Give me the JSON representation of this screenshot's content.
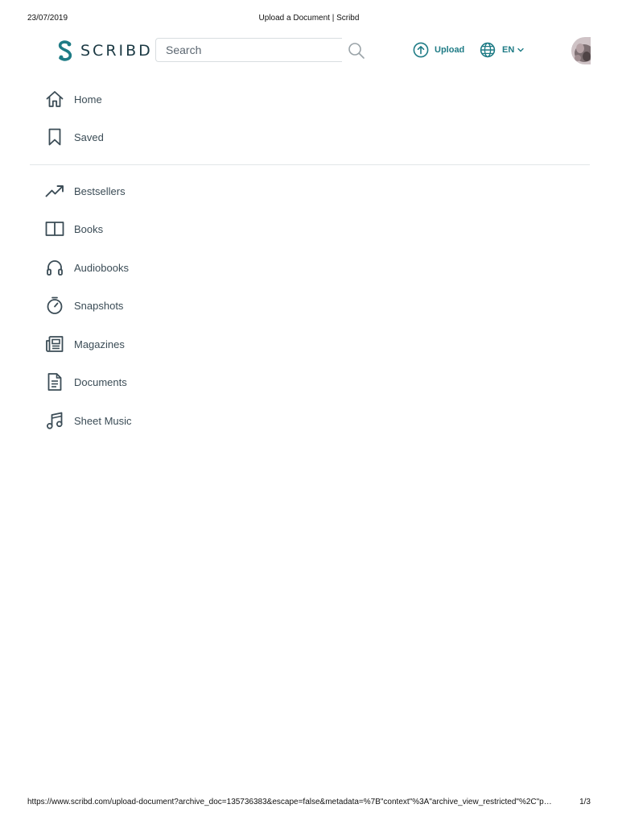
{
  "print": {
    "date": "23/07/2019",
    "title": "Upload a Document | Scribd",
    "url": "https://www.scribd.com/upload-document?archive_doc=135736383&escape=false&metadata=%7B\"context\"%3A\"archive_view_restricted\"%2C\"p…",
    "page": "1/3"
  },
  "header": {
    "logo_text": "SCRIBD",
    "search_placeholder": "Search",
    "upload_label": "Upload",
    "language_label": "EN"
  },
  "nav": {
    "primary": [
      {
        "label": "Home",
        "icon": "home-icon"
      },
      {
        "label": "Saved",
        "icon": "bookmark-icon"
      }
    ],
    "categories": [
      {
        "label": "Bestsellers",
        "icon": "trending-icon"
      },
      {
        "label": "Books",
        "icon": "book-icon"
      },
      {
        "label": "Audiobooks",
        "icon": "headphones-icon"
      },
      {
        "label": "Snapshots",
        "icon": "stopwatch-icon"
      },
      {
        "label": "Magazines",
        "icon": "magazine-icon"
      },
      {
        "label": "Documents",
        "icon": "document-icon"
      },
      {
        "label": "Sheet Music",
        "icon": "music-note-icon"
      }
    ]
  },
  "colors": {
    "brand": "#1e7b85",
    "logo_text": "#1c3a44",
    "nav_icon": "#3b4c56"
  }
}
